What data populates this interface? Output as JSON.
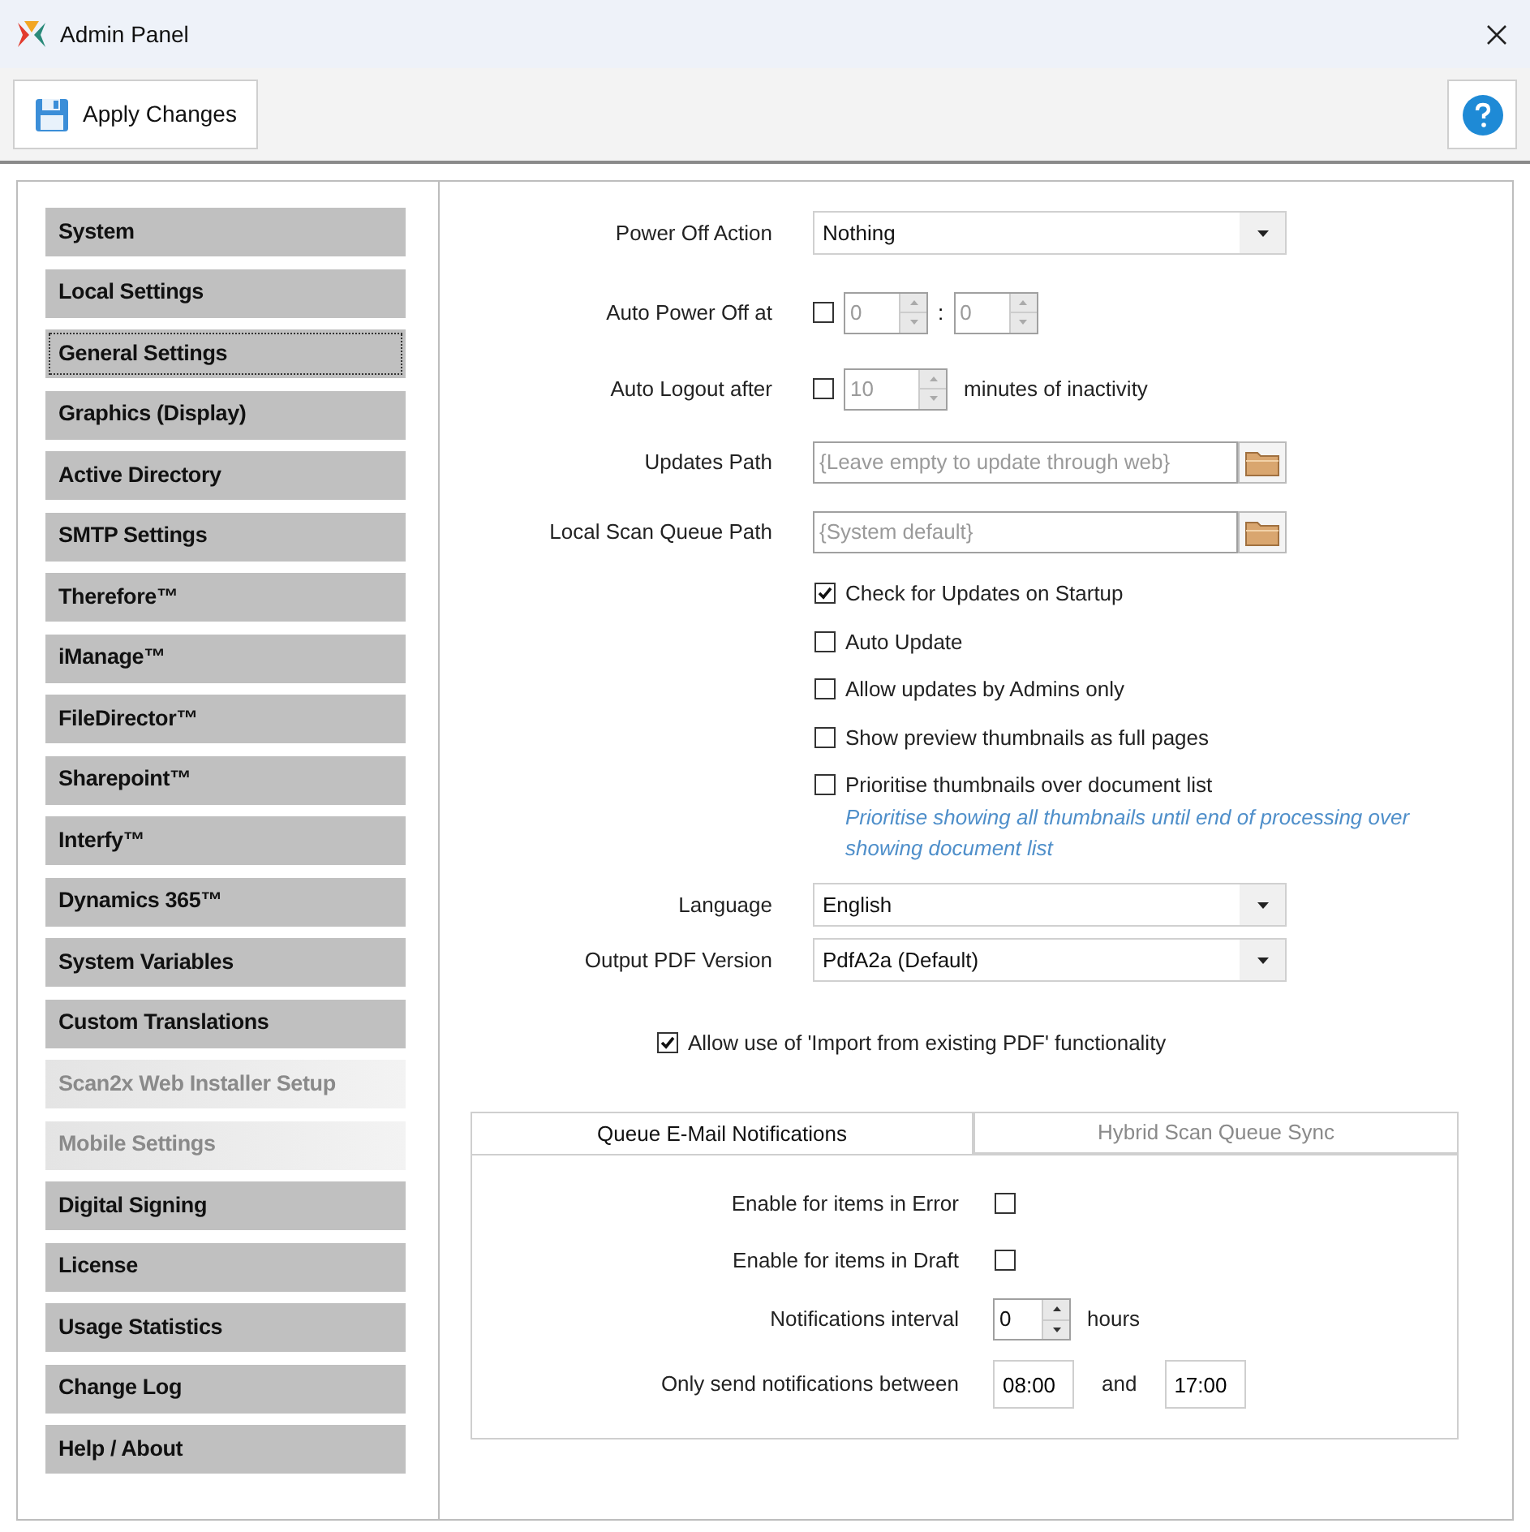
{
  "window": {
    "title": "Admin Panel"
  },
  "toolbar": {
    "apply_button": "Apply Changes"
  },
  "sidebar": {
    "items": [
      {
        "label": "System",
        "selected": false,
        "disabled": false
      },
      {
        "label": "Local Settings",
        "selected": false,
        "disabled": false
      },
      {
        "label": "General Settings",
        "selected": true,
        "disabled": false
      },
      {
        "label": "Graphics (Display)",
        "selected": false,
        "disabled": false
      },
      {
        "label": "Active Directory",
        "selected": false,
        "disabled": false
      },
      {
        "label": "SMTP Settings",
        "selected": false,
        "disabled": false
      },
      {
        "label": "Therefore™",
        "selected": false,
        "disabled": false
      },
      {
        "label": "iManage™",
        "selected": false,
        "disabled": false
      },
      {
        "label": "FileDirector™",
        "selected": false,
        "disabled": false
      },
      {
        "label": "Sharepoint™",
        "selected": false,
        "disabled": false
      },
      {
        "label": "Interfy™",
        "selected": false,
        "disabled": false
      },
      {
        "label": "Dynamics 365™",
        "selected": false,
        "disabled": false
      },
      {
        "label": "System Variables",
        "selected": false,
        "disabled": false
      },
      {
        "label": "Custom Translations",
        "selected": false,
        "disabled": false
      },
      {
        "label": "Scan2x Web Installer Setup",
        "selected": false,
        "disabled": true
      },
      {
        "label": "Mobile Settings",
        "selected": false,
        "disabled": true
      },
      {
        "label": "Digital Signing",
        "selected": false,
        "disabled": false
      },
      {
        "label": "License",
        "selected": false,
        "disabled": false
      },
      {
        "label": "Usage Statistics",
        "selected": false,
        "disabled": false
      },
      {
        "label": "Change Log",
        "selected": false,
        "disabled": false
      },
      {
        "label": "Help / About",
        "selected": false,
        "disabled": false
      }
    ]
  },
  "form": {
    "power_off_action": {
      "label": "Power Off Action",
      "value": "Nothing"
    },
    "auto_power_off": {
      "label": "Auto Power Off at",
      "checked": false,
      "hours": "0",
      "separator": ":",
      "minutes": "0"
    },
    "auto_logout": {
      "label": "Auto Logout after",
      "checked": false,
      "value": "10",
      "suffix": "minutes of inactivity"
    },
    "updates_path": {
      "label": "Updates Path",
      "placeholder": "{Leave empty to update through web}"
    },
    "scan_queue_path": {
      "label": "Local Scan Queue Path",
      "placeholder": "{System default}"
    },
    "checkboxes": [
      {
        "label": "Check for Updates on Startup",
        "checked": true
      },
      {
        "label": "Auto Update",
        "checked": false
      },
      {
        "label": "Allow updates by Admins only",
        "checked": false
      },
      {
        "label": "Show preview thumbnails as full pages",
        "checked": false
      },
      {
        "label": "Prioritise thumbnails over document list",
        "checked": false,
        "hint": "Prioritise showing all thumbnails until end of processing over showing document list"
      }
    ],
    "language": {
      "label": "Language",
      "value": "English"
    },
    "output_pdf_version": {
      "label": "Output PDF Version",
      "value": "PdfA2a (Default)"
    },
    "import_pdf": {
      "label": "Allow use of 'Import from existing PDF' functionality",
      "checked": true
    }
  },
  "tabs": [
    {
      "label": "Queue E-Mail Notifications",
      "selected": true
    },
    {
      "label": "Hybrid Scan Queue Sync",
      "selected": false
    }
  ],
  "notifications": {
    "error": {
      "label": "Enable for items in Error",
      "checked": false
    },
    "draft": {
      "label": "Enable for items in Draft",
      "checked": false
    },
    "interval": {
      "label": "Notifications interval",
      "value": "0",
      "suffix": "hours"
    },
    "between": {
      "label": "Only send notifications between",
      "from": "08:00",
      "conjunction": "and",
      "to": "17:00"
    }
  }
}
